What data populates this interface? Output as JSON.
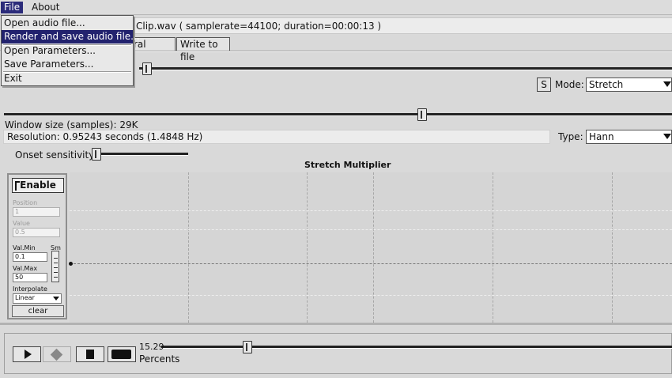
{
  "menubar": {
    "file": "File",
    "about": "About"
  },
  "file_menu": {
    "items": [
      "Open audio file...",
      "Render and save audio file...",
      "Open Parameters...",
      "Save Parameters...",
      "Exit"
    ],
    "selected": "Render and save audio file..."
  },
  "fileinfo": "Clip.wav ( samplerate=44100; duration=00:00:13 )",
  "tabs": {
    "general": "ral beats",
    "write": "Write to file"
  },
  "mode": {
    "s_button": "S",
    "label": "Mode:",
    "value": "Stretch"
  },
  "window": {
    "size_label": "Window size (samples): 29K"
  },
  "resolution": "Resolution: 0.95243 seconds (1.4848 Hz)",
  "type": {
    "label": "Type:",
    "value": "Hann"
  },
  "onset": {
    "label": "Onset sensitivity:"
  },
  "graph": {
    "title": "Stretch Multiplier"
  },
  "panel": {
    "enable": "Enable",
    "position_label": "Position",
    "position_value": "1",
    "value_label": "Value",
    "value_value": "0.5",
    "valmin_label": "Val.Min",
    "valmin_value": "0.1",
    "valmax_label": "Val.Max",
    "valmax_value": "50",
    "smooth_label": "Sm",
    "interpolate_label": "Interpolate",
    "interpolate_value": "Linear",
    "clear": "clear"
  },
  "transport": {
    "percent_value": "15.29",
    "percent_label": "Percents"
  },
  "sliders": {
    "top": 0.0,
    "window": 0.62,
    "onset": 0.0,
    "position": 0.16
  }
}
